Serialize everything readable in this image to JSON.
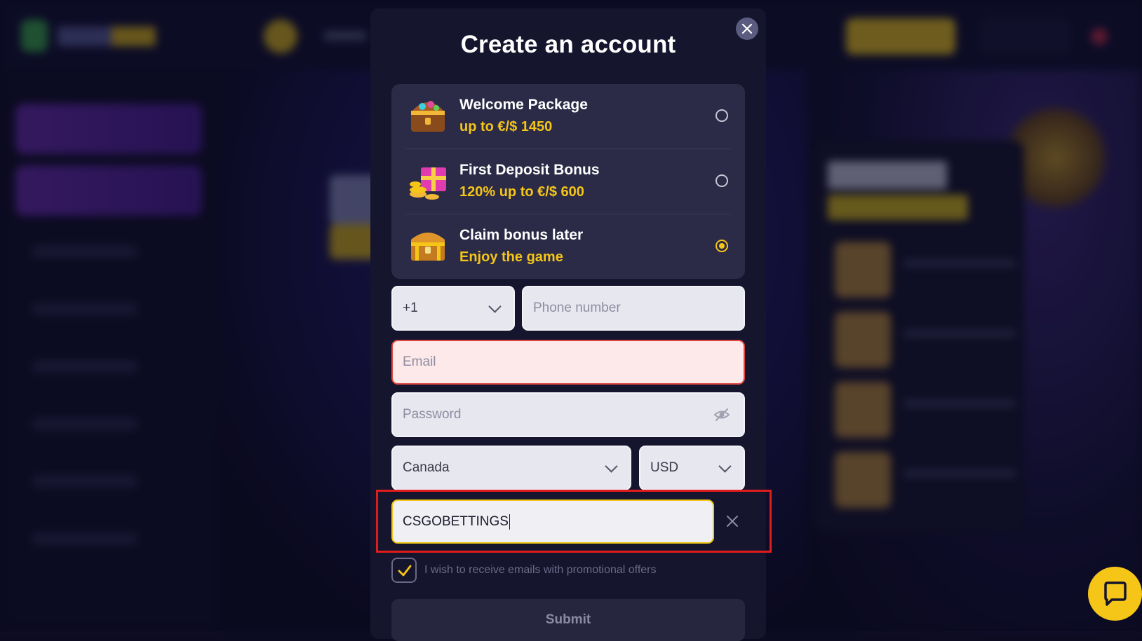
{
  "modal": {
    "title": "Create an account",
    "close_icon": "close-icon"
  },
  "bonuses": [
    {
      "title": "Welcome Package",
      "subtitle": "up to €/$ 1450",
      "icon": "treasure-chest-gems-icon",
      "selected": false
    },
    {
      "title": "First Deposit Bonus",
      "subtitle": "120% up to €/$ 600",
      "icon": "gift-coins-icon",
      "selected": false
    },
    {
      "title": "Claim bonus later",
      "subtitle": "Enjoy the game",
      "icon": "treasure-chest-icon",
      "selected": true
    }
  ],
  "form": {
    "phone_code": "+1",
    "phone_placeholder": "Phone number",
    "email_placeholder": "Email",
    "password_placeholder": "Password",
    "country": "Canada",
    "currency": "USD",
    "promo_code": "CSGOBETTINGS",
    "promo_checked": true,
    "promo_label": "I wish to receive emails with promotional offers",
    "submit_label": "Submit"
  },
  "colors": {
    "accent": "#f5c518",
    "modal_bg": "#15152e",
    "error": "#e0463f",
    "highlight": "#e01c1c"
  },
  "widgets": {
    "chat_icon": "chat-bubble-icon"
  }
}
